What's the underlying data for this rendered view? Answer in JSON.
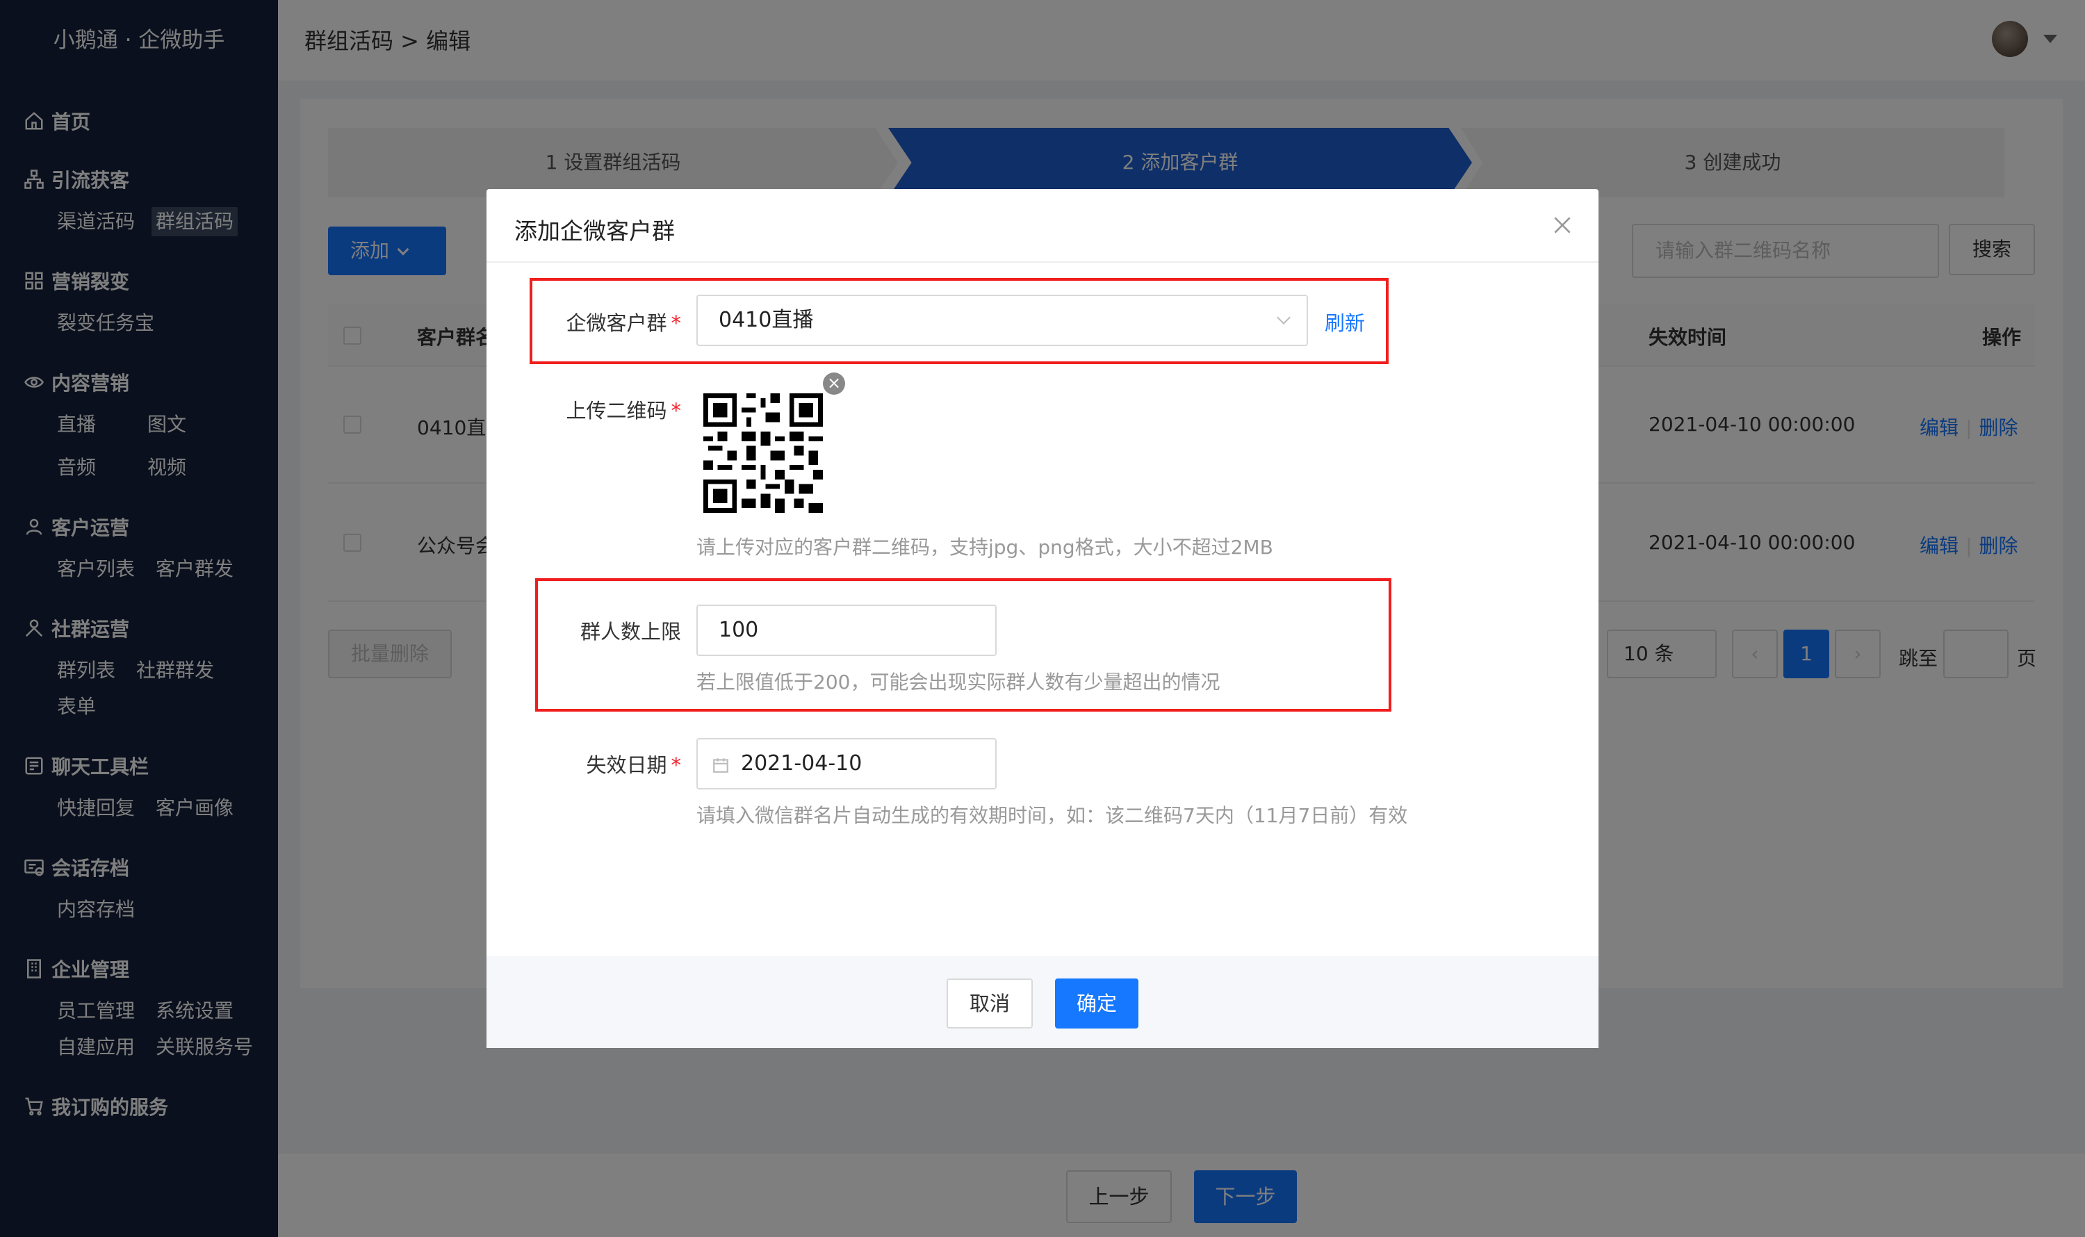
{
  "app": {
    "brand": "小鹅通 · 企微助手"
  },
  "sidebar": {
    "groups": [
      {
        "title": "首页",
        "icon": "home-icon",
        "items": []
      },
      {
        "title": "引流获客",
        "icon": "org-chart-icon",
        "items": [
          "渠道活码",
          "群组活码"
        ]
      },
      {
        "title": "营销裂变",
        "icon": "grid-icon",
        "items": [
          "裂变任务宝"
        ]
      },
      {
        "title": "内容营销",
        "icon": "eye-icon",
        "items": [
          "直播",
          "图文",
          "音频",
          "视频"
        ]
      },
      {
        "title": "客户运营",
        "icon": "user-icon",
        "items": [
          "客户列表",
          "客户群发"
        ]
      },
      {
        "title": "社群运营",
        "icon": "users-icon",
        "items": [
          "群列表",
          "社群群发",
          "表单"
        ]
      },
      {
        "title": "聊天工具栏",
        "icon": "chat-tool-icon",
        "items": [
          "快捷回复",
          "客户画像"
        ]
      },
      {
        "title": "会话存档",
        "icon": "archive-icon",
        "items": [
          "内容存档"
        ]
      },
      {
        "title": "企业管理",
        "icon": "building-icon",
        "items": [
          "员工管理",
          "系统设置",
          "自建应用",
          "关联服务号"
        ]
      },
      {
        "title": "我订购的服务",
        "icon": "cart-icon",
        "items": []
      }
    ],
    "active_item": "群组活码"
  },
  "header": {
    "breadcrumb": "群组活码 > 编辑"
  },
  "steps": [
    "1 设置群组活码",
    "2 添加客户群",
    "3 创建成功"
  ],
  "toolbar": {
    "add_label": "添加",
    "search_placeholder": "请输入群二维码名称",
    "search_label": "搜索"
  },
  "table": {
    "columns": {
      "name": "客户群名",
      "expire": "失效时间",
      "actions": "操作"
    },
    "rows": [
      {
        "name": "0410直",
        "expire": "2021-04-10 00:00:00",
        "edit": "编辑",
        "delete": "删除"
      },
      {
        "name": "公众号会",
        "expire": "2021-04-10 00:00:00",
        "edit": "编辑",
        "delete": "删除"
      }
    ],
    "batch_delete": "批量删除"
  },
  "pagination": {
    "page_size": "10 条",
    "current": "1",
    "jump_label": "跳至",
    "page_suffix": "页"
  },
  "footer": {
    "prev": "上一步",
    "next": "下一步"
  },
  "modal": {
    "title": "添加企微客户群",
    "group_label": "企微客户群",
    "group_value": "0410直播",
    "refresh": "刷新",
    "qr_label": "上传二维码",
    "qr_hint": "请上传对应的客户群二维码，支持jpg、png格式，大小不超过2MB",
    "limit_label": "群人数上限",
    "limit_value": "100",
    "limit_hint": "若上限值低于200，可能会出现实际群人数有少量超出的情况",
    "date_label": "失效日期",
    "date_value": "2021-04-10",
    "date_hint": "请填入微信群名片自动生成的有效期时间，如：该二维码7天内（11月7日前）有效",
    "cancel": "取消",
    "confirm": "确定"
  },
  "colors": {
    "primary": "#1677ff",
    "sidebar_bg": "#14213a",
    "highlight": "#f01e1e"
  }
}
